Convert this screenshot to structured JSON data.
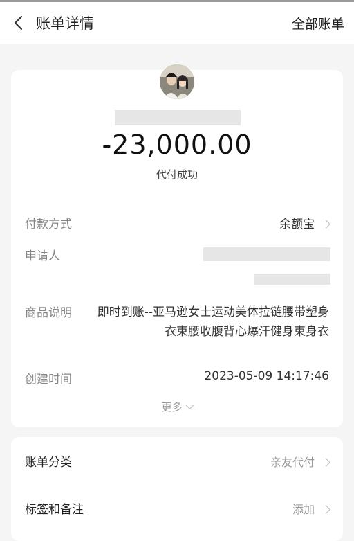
{
  "header": {
    "title": "账单详情",
    "right_link": "全部账单"
  },
  "summary": {
    "amount": "-23,000.00",
    "status": "代付成功"
  },
  "details": {
    "payment_method": {
      "label": "付款方式",
      "value": "余额宝"
    },
    "applicant": {
      "label": "申请人"
    },
    "product": {
      "label": "商品说明",
      "value": "即时到账--亚马逊女士运动美体拉链腰带塑身衣束腰收腹背心爆汗健身束身衣"
    },
    "created": {
      "label": "创建时间",
      "value": "2023-05-09 14:17:46"
    },
    "more": "更多"
  },
  "extra": {
    "category": {
      "label": "账单分类",
      "value": "亲友代付"
    },
    "tags": {
      "label": "标签和备注",
      "value": "添加"
    }
  },
  "icons": {
    "back": "back-arrow-icon",
    "chevron": "chevron-right-icon",
    "more": "chevron-down-icon"
  },
  "colors": {
    "background": "#f5f5f5",
    "card": "#ffffff",
    "secondary_text": "#888888"
  }
}
